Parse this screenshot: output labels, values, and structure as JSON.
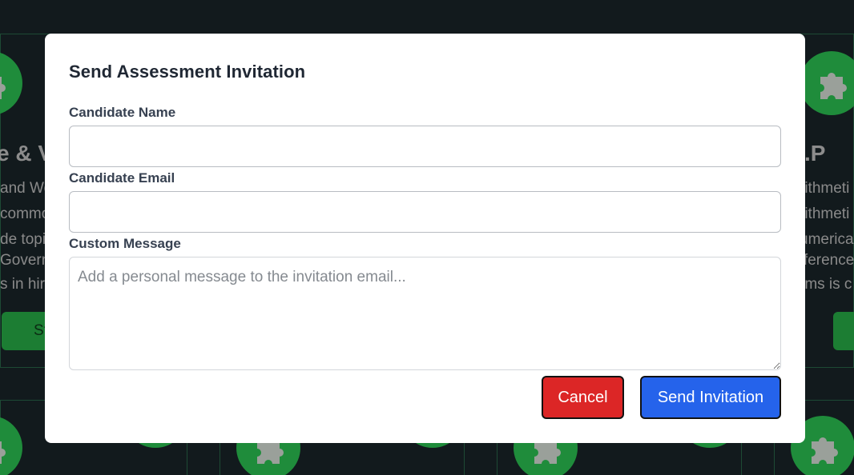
{
  "background": {
    "left_card": {
      "title_fragment": "e & V",
      "text_lines": [
        "and Wo",
        "commo",
        "de topi",
        "Govern",
        "s in hiri"
      ],
      "button_fragment": "St"
    },
    "right_card": {
      "title_fragment": ".P",
      "text_lines": [
        "rithmeti",
        "rithmeti",
        "umerica",
        "fference",
        "rms is c"
      ]
    },
    "icon": "puzzle-piece-icon",
    "accent_color": "#1f8c3b"
  },
  "modal": {
    "title": "Send Assessment Invitation",
    "fields": {
      "name": {
        "label": "Candidate Name",
        "value": "",
        "placeholder": ""
      },
      "email": {
        "label": "Candidate Email",
        "value": "",
        "placeholder": ""
      },
      "message": {
        "label": "Custom Message",
        "value": "",
        "placeholder": "Add a personal message to the invitation email..."
      }
    },
    "buttons": {
      "cancel": "Cancel",
      "send": "Send Invitation"
    },
    "colors": {
      "cancel": "#dc2626",
      "send": "#2563eb"
    }
  }
}
